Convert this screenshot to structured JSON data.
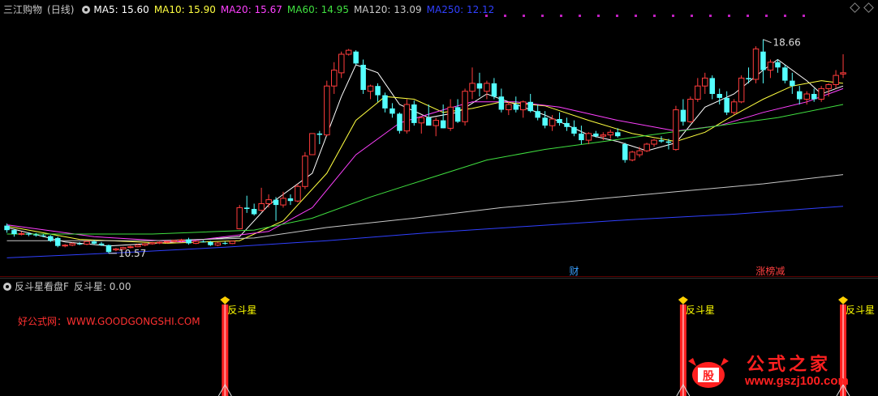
{
  "header": {
    "stock": "三江购物",
    "period": "(日线)",
    "ma": [
      {
        "label": "MA5: 15.60",
        "color": "#ffffff"
      },
      {
        "label": "MA10: 15.90",
        "color": "#ffff40"
      },
      {
        "label": "MA20: 15.67",
        "color": "#ff40ff"
      },
      {
        "label": "MA60: 14.95",
        "color": "#40e040"
      },
      {
        "label": "MA120: 13.09",
        "color": "#c8c8c8"
      },
      {
        "label": "MA250: 12.12",
        "color": "#3040ff"
      }
    ]
  },
  "indicator_header": {
    "name": "反斗星看盘F",
    "value_label": "反斗星: 0.00"
  },
  "source_text": "好公式网：WWW.GOODGONGSHI.COM",
  "logo": {
    "title": "公式之家",
    "url": "www.gszj100.com"
  },
  "markers": {
    "finance": "财",
    "dragon_tiger": "涨榜减"
  },
  "colors": {
    "up": "#ff3c3c",
    "down": "#54ffff",
    "background": "#000000",
    "signal": "#ff2020",
    "signal_label": "#ffff00"
  },
  "chart_data": {
    "type": "candlestick",
    "title": "三江购物 (日线)",
    "ylim": [
      9.8,
      19.6
    ],
    "annotations": [
      {
        "text": "18.66",
        "value": 18.66,
        "kind": "high"
      },
      {
        "text": "10.57",
        "value": 10.57,
        "kind": "low"
      }
    ],
    "candles": [
      [
        11.62,
        11.7,
        11.35,
        11.45
      ],
      [
        11.45,
        11.5,
        11.2,
        11.3
      ],
      [
        11.3,
        11.4,
        11.25,
        11.32
      ],
      [
        11.32,
        11.36,
        11.22,
        11.28
      ],
      [
        11.28,
        11.34,
        11.2,
        11.25
      ],
      [
        11.25,
        11.3,
        11.18,
        11.22
      ],
      [
        11.22,
        11.26,
        11.0,
        11.05
      ],
      [
        11.15,
        11.2,
        10.8,
        10.85
      ],
      [
        10.85,
        10.92,
        10.8,
        10.88
      ],
      [
        10.88,
        10.98,
        10.84,
        10.94
      ],
      [
        10.94,
        11.0,
        10.88,
        10.92
      ],
      [
        10.92,
        11.05,
        10.88,
        11.02
      ],
      [
        11.02,
        11.08,
        10.9,
        10.94
      ],
      [
        10.94,
        11.0,
        10.85,
        10.88
      ],
      [
        10.88,
        10.9,
        10.57,
        10.62
      ],
      [
        10.7,
        10.78,
        10.65,
        10.74
      ],
      [
        10.74,
        10.82,
        10.7,
        10.79
      ],
      [
        10.79,
        10.86,
        10.76,
        10.82
      ],
      [
        10.82,
        10.92,
        10.8,
        10.88
      ],
      [
        10.88,
        10.96,
        10.84,
        10.93
      ],
      [
        10.93,
        11.0,
        10.9,
        10.97
      ],
      [
        10.97,
        11.02,
        10.92,
        10.99
      ],
      [
        10.99,
        11.04,
        10.95,
        11.02
      ],
      [
        11.02,
        11.08,
        10.98,
        11.06
      ],
      [
        11.06,
        11.12,
        11.0,
        11.08
      ],
      [
        11.1,
        11.16,
        10.9,
        10.95
      ],
      [
        10.95,
        11.05,
        10.92,
        11.02
      ],
      [
        11.02,
        11.06,
        10.98,
        11.0
      ],
      [
        11.0,
        11.04,
        10.85,
        10.88
      ],
      [
        10.88,
        11.0,
        10.84,
        10.96
      ],
      [
        10.96,
        11.02,
        10.9,
        10.94
      ],
      [
        10.94,
        11.05,
        10.92,
        11.03
      ],
      [
        11.5,
        12.4,
        11.48,
        12.3
      ],
      [
        12.3,
        12.75,
        12.1,
        12.25
      ],
      [
        12.25,
        12.45,
        12.0,
        12.05
      ],
      [
        12.2,
        13.05,
        12.15,
        12.45
      ],
      [
        12.45,
        12.8,
        12.3,
        12.6
      ],
      [
        12.6,
        12.7,
        11.8,
        12.4
      ],
      [
        12.4,
        12.9,
        12.3,
        12.65
      ],
      [
        12.65,
        12.8,
        12.4,
        12.55
      ],
      [
        12.55,
        13.2,
        12.5,
        13.1
      ],
      [
        13.1,
        14.4,
        13.0,
        14.25
      ],
      [
        14.3,
        15.1,
        14.3,
        15.1
      ],
      [
        15.1,
        15.2,
        14.7,
        15.05
      ],
      [
        15.05,
        17.1,
        15.0,
        16.9
      ],
      [
        16.9,
        17.8,
        16.6,
        17.5
      ],
      [
        17.4,
        18.2,
        17.2,
        18.1
      ],
      [
        18.1,
        18.3,
        18.05,
        18.25
      ],
      [
        18.2,
        18.25,
        17.7,
        17.75
      ],
      [
        17.7,
        17.9,
        16.6,
        16.75
      ],
      [
        16.7,
        16.95,
        16.4,
        16.9
      ],
      [
        16.9,
        17.0,
        16.3,
        16.55
      ],
      [
        16.55,
        16.65,
        15.9,
        16.05
      ],
      [
        16.05,
        16.25,
        15.7,
        15.85
      ],
      [
        15.85,
        15.9,
        15.1,
        15.2
      ],
      [
        15.2,
        16.4,
        15.1,
        16.2
      ],
      [
        16.2,
        16.35,
        15.4,
        15.5
      ],
      [
        15.5,
        15.75,
        15.1,
        15.7
      ],
      [
        15.7,
        16.2,
        15.5,
        15.4
      ],
      [
        15.4,
        15.7,
        15.0,
        15.6
      ],
      [
        15.6,
        16.2,
        15.3,
        15.3
      ],
      [
        15.3,
        16.4,
        15.2,
        16.1
      ],
      [
        16.1,
        16.4,
        15.5,
        15.55
      ],
      [
        15.55,
        16.8,
        15.4,
        16.7
      ],
      [
        16.7,
        17.6,
        16.4,
        17.0
      ],
      [
        17.0,
        17.4,
        16.5,
        16.8
      ],
      [
        16.7,
        17.1,
        16.4,
        17.0
      ],
      [
        17.0,
        17.2,
        16.4,
        16.5
      ],
      [
        16.5,
        16.8,
        15.9,
        16.0
      ],
      [
        16.0,
        16.3,
        15.8,
        16.2
      ],
      [
        16.2,
        16.5,
        15.9,
        16.0
      ],
      [
        16.0,
        16.35,
        15.7,
        16.3
      ],
      [
        16.3,
        16.6,
        15.9,
        15.95
      ],
      [
        15.95,
        16.2,
        15.6,
        15.7
      ],
      [
        15.7,
        15.95,
        15.3,
        15.4
      ],
      [
        15.4,
        15.8,
        15.2,
        15.65
      ],
      [
        15.65,
        15.9,
        15.4,
        15.5
      ],
      [
        15.5,
        15.7,
        15.2,
        15.35
      ],
      [
        15.35,
        15.6,
        15.0,
        15.1
      ],
      [
        15.1,
        15.4,
        14.7,
        14.85
      ],
      [
        14.85,
        15.15,
        14.7,
        15.1
      ],
      [
        15.1,
        15.2,
        14.95,
        15.0
      ],
      [
        15.0,
        15.15,
        14.85,
        15.05
      ],
      [
        15.05,
        15.25,
        14.9,
        15.15
      ],
      [
        15.15,
        15.3,
        14.95,
        15.0
      ],
      [
        14.7,
        14.75,
        14.0,
        14.1
      ],
      [
        14.1,
        14.45,
        14.05,
        14.4
      ],
      [
        14.3,
        14.6,
        14.2,
        14.45
      ],
      [
        14.45,
        14.75,
        14.4,
        14.7
      ],
      [
        14.7,
        14.9,
        14.6,
        14.85
      ],
      [
        14.85,
        15.0,
        14.75,
        14.8
      ],
      [
        14.8,
        14.9,
        14.5,
        14.75
      ],
      [
        14.5,
        16.15,
        14.45,
        16.0
      ],
      [
        16.0,
        16.4,
        15.4,
        15.55
      ],
      [
        15.55,
        16.5,
        15.5,
        16.4
      ],
      [
        16.4,
        17.2,
        16.3,
        16.9
      ],
      [
        16.9,
        17.4,
        16.6,
        17.2
      ],
      [
        17.2,
        17.3,
        16.4,
        16.6
      ],
      [
        16.6,
        16.8,
        16.2,
        16.45
      ],
      [
        16.45,
        16.7,
        15.8,
        15.9
      ],
      [
        15.9,
        16.4,
        15.8,
        16.3
      ],
      [
        16.3,
        17.3,
        16.25,
        17.2
      ],
      [
        17.2,
        17.6,
        17.0,
        17.15
      ],
      [
        17.15,
        18.4,
        17.0,
        18.3
      ],
      [
        18.2,
        18.66,
        17.0,
        17.5
      ],
      [
        17.5,
        17.9,
        17.2,
        17.8
      ],
      [
        17.8,
        17.9,
        17.4,
        17.6
      ],
      [
        17.6,
        17.7,
        17.0,
        17.1
      ],
      [
        17.1,
        17.4,
        16.6,
        16.9
      ],
      [
        16.7,
        16.9,
        16.2,
        16.4
      ],
      [
        16.4,
        16.7,
        16.2,
        16.6
      ],
      [
        16.6,
        16.8,
        16.3,
        16.4
      ],
      [
        16.4,
        16.9,
        16.3,
        16.8
      ],
      [
        16.8,
        17.0,
        16.5,
        16.95
      ],
      [
        16.95,
        17.5,
        16.8,
        17.3
      ],
      [
        17.35,
        18.1,
        17.2,
        17.4
      ]
    ],
    "ma_series": [
      {
        "name": "MA5",
        "values": [
          [
            0,
            11.55
          ],
          [
            8,
            11.0
          ],
          [
            14,
            10.85
          ],
          [
            22,
            10.98
          ],
          [
            32,
            11.2
          ],
          [
            36,
            12.4
          ],
          [
            42,
            13.6
          ],
          [
            46,
            16.5
          ],
          [
            48,
            17.7
          ],
          [
            51,
            17.4
          ],
          [
            54,
            16.2
          ],
          [
            58,
            15.7
          ],
          [
            62,
            15.9
          ],
          [
            66,
            16.6
          ],
          [
            70,
            16.2
          ],
          [
            74,
            15.8
          ],
          [
            80,
            15.05
          ],
          [
            84,
            14.8
          ],
          [
            88,
            14.45
          ],
          [
            92,
            14.75
          ],
          [
            96,
            16.1
          ],
          [
            100,
            16.6
          ],
          [
            104,
            17.5
          ],
          [
            106,
            17.9
          ],
          [
            110,
            17.1
          ],
          [
            112,
            16.6
          ],
          [
            115,
            16.9
          ]
        ]
      },
      {
        "name": "MA10",
        "values": [
          [
            0,
            11.6
          ],
          [
            10,
            11.1
          ],
          [
            22,
            10.95
          ],
          [
            32,
            11.05
          ],
          [
            38,
            11.8
          ],
          [
            44,
            13.6
          ],
          [
            48,
            15.6
          ],
          [
            52,
            16.5
          ],
          [
            56,
            16.4
          ],
          [
            60,
            15.9
          ],
          [
            64,
            16.05
          ],
          [
            68,
            16.3
          ],
          [
            74,
            16.15
          ],
          [
            80,
            15.6
          ],
          [
            86,
            15.1
          ],
          [
            92,
            14.8
          ],
          [
            96,
            15.15
          ],
          [
            100,
            15.8
          ],
          [
            104,
            16.4
          ],
          [
            108,
            16.9
          ],
          [
            112,
            17.1
          ],
          [
            115,
            17.0
          ]
        ]
      },
      {
        "name": "MA20",
        "values": [
          [
            0,
            11.65
          ],
          [
            12,
            11.2
          ],
          [
            24,
            11.0
          ],
          [
            36,
            11.4
          ],
          [
            42,
            12.3
          ],
          [
            48,
            14.3
          ],
          [
            54,
            15.5
          ],
          [
            60,
            16.0
          ],
          [
            64,
            16.3
          ],
          [
            70,
            16.3
          ],
          [
            76,
            16.1
          ],
          [
            84,
            15.6
          ],
          [
            92,
            15.2
          ],
          [
            98,
            15.4
          ],
          [
            104,
            15.9
          ],
          [
            110,
            16.3
          ],
          [
            115,
            16.8
          ]
        ]
      },
      {
        "name": "MA60",
        "values": [
          [
            0,
            11.3
          ],
          [
            20,
            11.3
          ],
          [
            34,
            11.45
          ],
          [
            42,
            11.9
          ],
          [
            50,
            12.7
          ],
          [
            58,
            13.4
          ],
          [
            66,
            14.1
          ],
          [
            74,
            14.5
          ],
          [
            82,
            14.8
          ],
          [
            90,
            15.1
          ],
          [
            98,
            15.4
          ],
          [
            106,
            15.7
          ],
          [
            115,
            16.2
          ]
        ]
      },
      {
        "name": "MA120",
        "values": [
          [
            0,
            11.05
          ],
          [
            20,
            11.05
          ],
          [
            34,
            11.15
          ],
          [
            44,
            11.55
          ],
          [
            56,
            11.9
          ],
          [
            68,
            12.3
          ],
          [
            80,
            12.6
          ],
          [
            92,
            12.9
          ],
          [
            104,
            13.2
          ],
          [
            115,
            13.55
          ]
        ]
      },
      {
        "name": "MA250",
        "values": [
          [
            0,
            10.4
          ],
          [
            16,
            10.6
          ],
          [
            30,
            10.8
          ],
          [
            44,
            11.05
          ],
          [
            58,
            11.35
          ],
          [
            72,
            11.6
          ],
          [
            86,
            11.85
          ],
          [
            100,
            12.05
          ],
          [
            115,
            12.35
          ]
        ]
      }
    ],
    "event_marks": [
      {
        "index": 78,
        "label": "财"
      },
      {
        "index": 105,
        "label": "涨榜减"
      }
    ],
    "signals": [
      {
        "index": 30,
        "label": "反斗星"
      },
      {
        "index": 93,
        "label": "反斗星"
      },
      {
        "index": 115,
        "label": "反斗星"
      }
    ]
  }
}
